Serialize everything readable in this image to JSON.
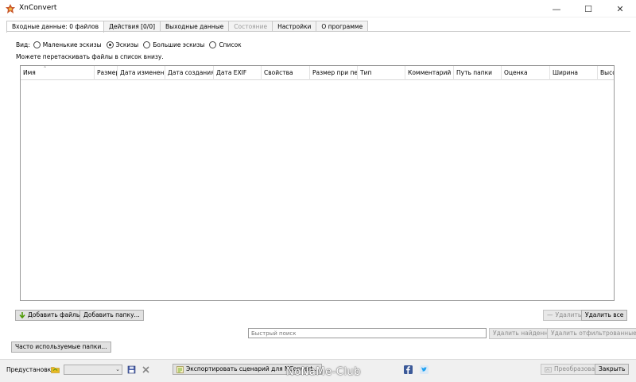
{
  "window": {
    "title": "XnConvert",
    "minimize_glyph": "—",
    "maximize_glyph": "☐",
    "close_glyph": "✕"
  },
  "tabs": [
    {
      "label": "Входные данные: 0 файлов",
      "active": true
    },
    {
      "label": "Действия [0/0]"
    },
    {
      "label": "Выходные данные"
    },
    {
      "label": "Состояние",
      "disabled": true
    },
    {
      "label": "Настройки"
    },
    {
      "label": "О программе"
    }
  ],
  "view": {
    "label": "Вид:",
    "options": [
      "Маленькие эскизы",
      "Эскизы",
      "Большие эскизы",
      "Список"
    ],
    "selected": "Эскизы"
  },
  "hint": "Можете перетаскивать файлы в список внизу.",
  "table": {
    "columns": [
      "Имя",
      "Размер",
      "Дата изменения",
      "Дата создания",
      "Дата EXIF",
      "Свойства",
      "Размер при печа",
      "Тип",
      "Комментарий",
      "Путь папки",
      "Оценка",
      "Ширина",
      "Высо"
    ],
    "sort_glyph": "⌃"
  },
  "buttons": {
    "add_files": "Добавить файлы...",
    "add_folder": "Добавить папку...",
    "remove": "Удалить",
    "remove_all": "Удалить все",
    "remove_found": "Удалить найденные",
    "remove_filtered": "Удалить отфильтрованные",
    "recent_folders": "Часто используемые папки...",
    "export_script": "Экспортировать сценарий для NConvert...",
    "convert": "Преобразовать",
    "close": "Закрыть"
  },
  "search": {
    "placeholder": "Быстрый поиск"
  },
  "presets": {
    "label": "Предустановки:",
    "value": ""
  },
  "watermark": "NoNaMe-Club",
  "colors": {
    "facebook": "#3b5998",
    "twitter": "#1da1f2",
    "add_icon": "#4e9a06",
    "folder_icon": "#e8b923"
  }
}
